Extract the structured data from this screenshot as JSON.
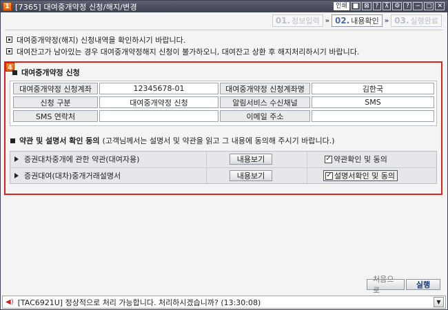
{
  "window": {
    "title": "[7365] 대여중개약정 신청/해지/변경",
    "title_num": "1",
    "controls": [
      "인쇄",
      "■",
      "⊠",
      "?",
      "⊼",
      "⚙",
      "?",
      "−",
      "□",
      "✕"
    ]
  },
  "steps": [
    {
      "num": "01.",
      "label": "정보입력",
      "state": "inactive"
    },
    {
      "num": "02.",
      "label": "내용확인",
      "state": "active"
    },
    {
      "num": "03.",
      "label": "실행완료",
      "state": "inactive"
    }
  ],
  "step_arrow": "»",
  "notices": [
    "대여중개약정(해지) 신청내역을 확인하시기 바랍니다.",
    "대여잔고가 남아있는 경우 대여중개약정해지 신청이 불가하오니, 대여잔고 상환 후 해지처리하시기 바랍니다."
  ],
  "badge": "4",
  "application": {
    "title": "대여중개약정 신청",
    "rows": [
      {
        "label1": "대여중개약정 신청계좌",
        "value1": "12345678-01",
        "label2": "대여중개약정 신청계좌명",
        "value2": "김한국"
      },
      {
        "label1": "신청 구분",
        "value1": "대여중개약정 신청",
        "label2": "알림서비스 수신채널",
        "value2": "SMS"
      },
      {
        "label1": "SMS 연락처",
        "value1": "",
        "label2": "이메일 주소",
        "value2": ""
      }
    ]
  },
  "terms": {
    "title": "약관 및 설명서 확인 동의",
    "subtitle": "(고객님께서는 설명서 및 약관을 읽고 그 내용에 동의해 주시기 바랍니다.)",
    "rows": [
      {
        "name": "증권대차중개에 관한 약관(대여자용)",
        "button": "내용보기",
        "check_label": "약관확인 및 동의",
        "checked": true
      },
      {
        "name": "증권대여(대차)중개거래설명서",
        "button": "내용보기",
        "check_label": "설명서확인 및 동의",
        "checked": true
      }
    ]
  },
  "buttons": {
    "reset": "처음으로",
    "run": "실행"
  },
  "status": {
    "message": "[TAC6921U] 정상적으로 처리 가능합니다. 처리하시겠습니까? (13:30:08)",
    "speaker_icon": "speaker-icon"
  },
  "colors": {
    "highlight_border": "#e0201c",
    "badge": "#f07010",
    "active_step": "#4c6aa6"
  }
}
